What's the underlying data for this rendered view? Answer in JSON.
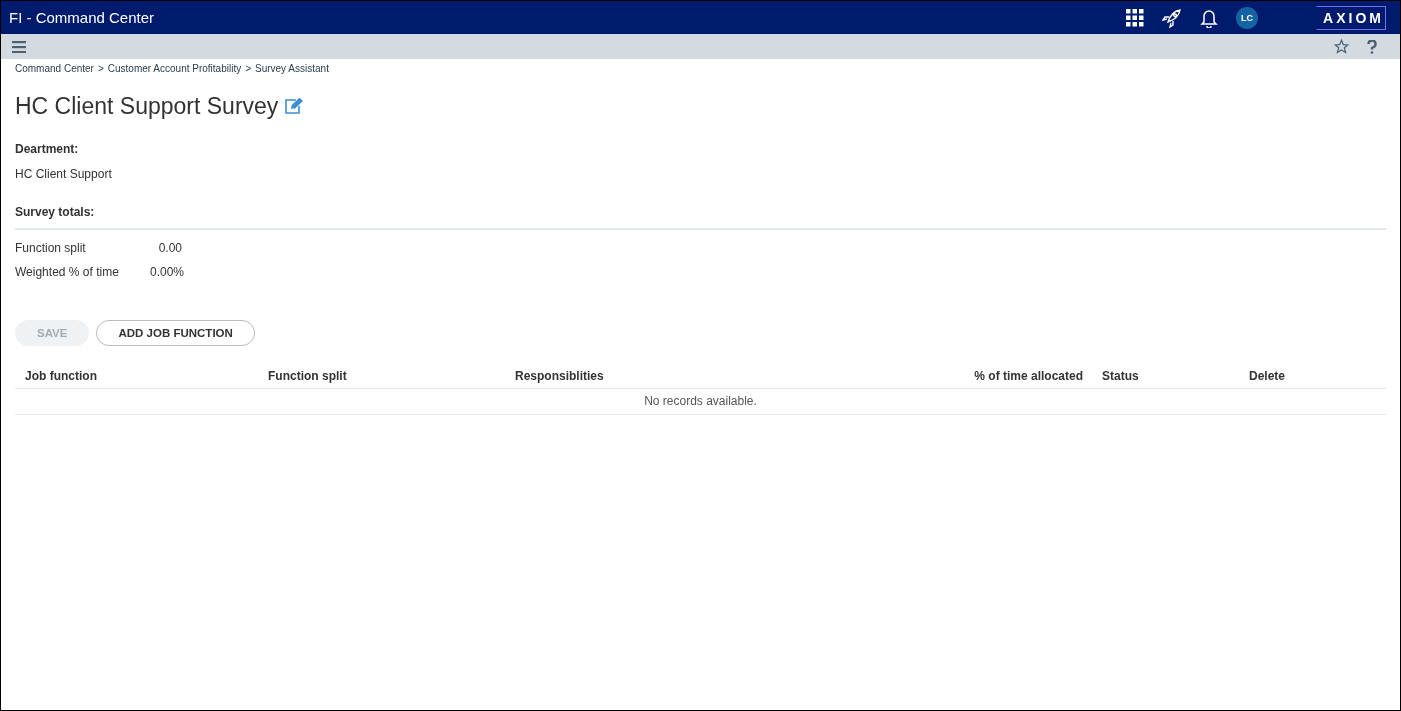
{
  "app_bar": {
    "title": "FI - Command Center",
    "avatar": "LC",
    "logo": "AXIOM"
  },
  "breadcrumb": [
    "Command Center",
    "Customer Account Profitability",
    "Survey Assistant"
  ],
  "breadcrumb_separator": ">",
  "page_title": "HC Client Support Survey",
  "department": {
    "label": "Deartment:",
    "value": "HC Client Support"
  },
  "totals": {
    "label": "Survey totals:",
    "rows": [
      {
        "label": "Function split",
        "value": "0.00"
      },
      {
        "label": "Weighted % of time",
        "value": "0.00%"
      }
    ]
  },
  "buttons": [
    {
      "label": "SAVE",
      "disabled": true
    },
    {
      "label": "ADD JOB FUNCTION",
      "disabled": false
    }
  ],
  "table": {
    "columns": [
      {
        "label": "Job function"
      },
      {
        "label": "Function split"
      },
      {
        "label": "Responsiblities"
      },
      {
        "label": "% of time allocated"
      },
      {
        "label": "Status"
      },
      {
        "label": "Delete"
      }
    ],
    "empty_message": "No records available."
  }
}
